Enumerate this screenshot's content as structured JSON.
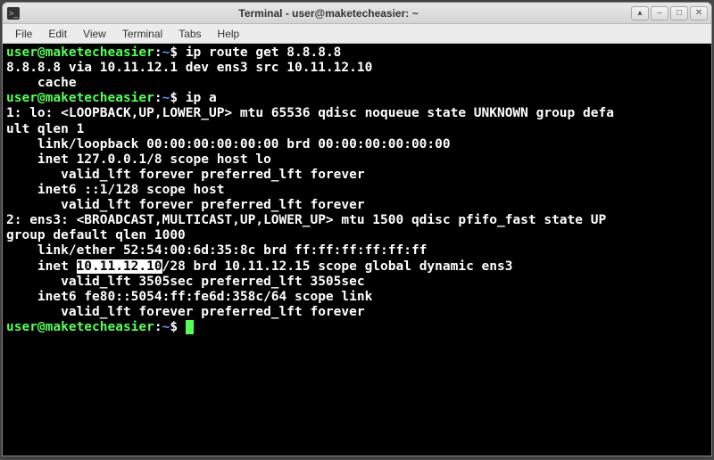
{
  "window": {
    "title": "Terminal - user@maketecheasier: ~"
  },
  "menubar": {
    "items": [
      "File",
      "Edit",
      "View",
      "Terminal",
      "Tabs",
      "Help"
    ]
  },
  "prompt": {
    "userhost": "user@maketecheasier",
    "sep": ":",
    "path": "~",
    "suffix": "$ "
  },
  "session": {
    "cmd1": "ip route get 8.8.8.8",
    "out1_l1": "8.8.8.8 via 10.11.12.1 dev ens3 src 10.11.12.10",
    "out1_l2": "    cache",
    "cmd2": "ip a",
    "out2_l01": "1: lo: <LOOPBACK,UP,LOWER_UP> mtu 65536 qdisc noqueue state UNKNOWN group defa",
    "out2_l02": "ult qlen 1",
    "out2_l03": "    link/loopback 00:00:00:00:00:00 brd 00:00:00:00:00:00",
    "out2_l04": "    inet 127.0.0.1/8 scope host lo",
    "out2_l05": "       valid_lft forever preferred_lft forever",
    "out2_l06": "    inet6 ::1/128 scope host",
    "out2_l07": "       valid_lft forever preferred_lft forever",
    "out2_l08": "2: ens3: <BROADCAST,MULTICAST,UP,LOWER_UP> mtu 1500 qdisc pfifo_fast state UP ",
    "out2_l09": "group default qlen 1000",
    "out2_l10": "    link/ether 52:54:00:6d:35:8c brd ff:ff:ff:ff:ff:ff",
    "out2_l11a": "    inet ",
    "out2_l11_hl": "10.11.12.10",
    "out2_l11b": "/28 brd 10.11.12.15 scope global dynamic ens3",
    "out2_l12": "       valid_lft 3505sec preferred_lft 3505sec",
    "out2_l13": "    inet6 fe80::5054:ff:fe6d:358c/64 scope link",
    "out2_l14": "       valid_lft forever preferred_lft forever"
  }
}
